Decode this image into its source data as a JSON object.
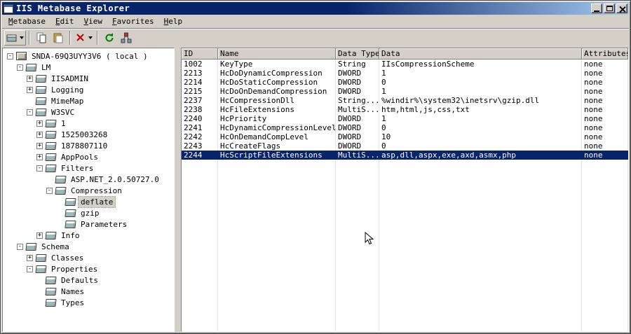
{
  "window": {
    "title": "IIS Metabase Explorer",
    "controls": {
      "minimize": "minimize",
      "maximize": "maximize",
      "close": "close"
    }
  },
  "colors": {
    "titlebar_start": "#0a246a",
    "titlebar_end": "#a6caf0",
    "selection": "#0a246a",
    "chrome": "#d4d0c8"
  },
  "menu": {
    "items": [
      {
        "label": "Metabase"
      },
      {
        "label": "Edit"
      },
      {
        "label": "View"
      },
      {
        "label": "Favorites"
      },
      {
        "label": "Help"
      }
    ]
  },
  "toolbar": {
    "buttons": [
      {
        "name": "new-key",
        "icon": "new-key-icon",
        "has_dropdown": true
      },
      {
        "name": "copy",
        "icon": "copy-icon"
      },
      {
        "name": "paste",
        "icon": "paste-icon"
      },
      {
        "name": "delete",
        "icon": "delete-icon",
        "has_dropdown": true
      },
      {
        "name": "refresh",
        "icon": "refresh-icon"
      },
      {
        "name": "connect",
        "icon": "connect-icon"
      }
    ]
  },
  "tree": {
    "items": [
      {
        "label": "SNDA-69Q3UYY3V6 ( local )",
        "level": 0,
        "expander": "minus",
        "icon": "computer"
      },
      {
        "label": "LM",
        "level": 1,
        "expander": "minus",
        "icon": "node"
      },
      {
        "label": "IISADMIN",
        "level": 2,
        "expander": "plus",
        "icon": "node"
      },
      {
        "label": "Logging",
        "level": 2,
        "expander": "plus",
        "icon": "node"
      },
      {
        "label": "MimeMap",
        "level": 2,
        "expander": "none",
        "icon": "node"
      },
      {
        "label": "W3SVC",
        "level": 2,
        "expander": "minus",
        "icon": "node"
      },
      {
        "label": "1",
        "level": 3,
        "expander": "plus",
        "icon": "node"
      },
      {
        "label": "1525003268",
        "level": 3,
        "expander": "plus",
        "icon": "node"
      },
      {
        "label": "1878807110",
        "level": 3,
        "expander": "plus",
        "icon": "node"
      },
      {
        "label": "AppPools",
        "level": 3,
        "expander": "plus",
        "icon": "node"
      },
      {
        "label": "Filters",
        "level": 3,
        "expander": "minus",
        "icon": "node"
      },
      {
        "label": "ASP.NET_2.0.50727.0",
        "level": 4,
        "expander": "none",
        "icon": "node"
      },
      {
        "label": "Compression",
        "level": 4,
        "expander": "minus",
        "icon": "node"
      },
      {
        "label": "deflate",
        "level": 5,
        "expander": "none",
        "icon": "node",
        "selected": true
      },
      {
        "label": "gzip",
        "level": 5,
        "expander": "none",
        "icon": "node"
      },
      {
        "label": "Parameters",
        "level": 5,
        "expander": "none",
        "icon": "node"
      },
      {
        "label": "Info",
        "level": 3,
        "expander": "plus",
        "icon": "node"
      },
      {
        "label": "Schema",
        "level": 1,
        "expander": "minus",
        "icon": "node"
      },
      {
        "label": "Classes",
        "level": 2,
        "expander": "plus",
        "icon": "node"
      },
      {
        "label": "Properties",
        "level": 2,
        "expander": "minus",
        "icon": "node"
      },
      {
        "label": "Defaults",
        "level": 3,
        "expander": "none",
        "icon": "node"
      },
      {
        "label": "Names",
        "level": 3,
        "expander": "none",
        "icon": "node"
      },
      {
        "label": "Types",
        "level": 3,
        "expander": "none",
        "icon": "node"
      }
    ]
  },
  "table": {
    "columns": [
      "ID",
      "Name",
      "Data Type",
      "Data",
      "Attributes"
    ],
    "rows": [
      {
        "id": "1002",
        "name": "KeyType",
        "type": "String",
        "data": "IIsCompressionScheme",
        "attrs": "none"
      },
      {
        "id": "2213",
        "name": "HcDoDynamicCompression",
        "type": "DWORD",
        "data": "1",
        "attrs": "none"
      },
      {
        "id": "2214",
        "name": "HcDoStaticCompression",
        "type": "DWORD",
        "data": "0",
        "attrs": "none"
      },
      {
        "id": "2215",
        "name": "HcDoOnDemandCompression",
        "type": "DWORD",
        "data": "1",
        "attrs": "none"
      },
      {
        "id": "2237",
        "name": "HcCompressionDll",
        "type": "String...",
        "data": "%windir%\\system32\\inetsrv\\gzip.dll",
        "attrs": "none"
      },
      {
        "id": "2238",
        "name": "HcFileExtensions",
        "type": "MultiS...",
        "data": "htm,html,js,css,txt",
        "attrs": "none"
      },
      {
        "id": "2240",
        "name": "HcPriority",
        "type": "DWORD",
        "data": "1",
        "attrs": "none"
      },
      {
        "id": "2241",
        "name": "HcDynamicCompressionLevel",
        "type": "DWORD",
        "data": "0",
        "attrs": "none"
      },
      {
        "id": "2242",
        "name": "HcOnDemandCompLevel",
        "type": "DWORD",
        "data": "10",
        "attrs": "none"
      },
      {
        "id": "2243",
        "name": "HcCreateFlags",
        "type": "DWORD",
        "data": "0",
        "attrs": "none"
      },
      {
        "id": "2244",
        "name": "HcScriptFileExtensions",
        "type": "MultiS...",
        "data": "asp,dll,aspx,exe,axd,asmx,php",
        "attrs": "none",
        "selected": true
      }
    ]
  }
}
